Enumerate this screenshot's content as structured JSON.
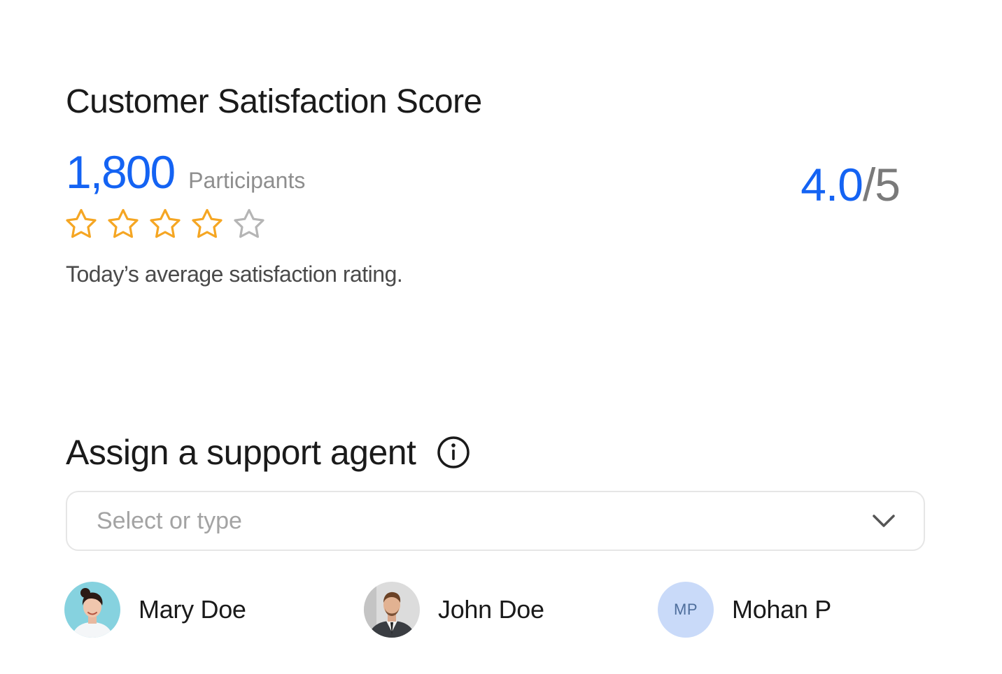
{
  "csat": {
    "title": "Customer Satisfaction Score",
    "participant_count": "1,800",
    "participants_label": "Participants",
    "rating": 4,
    "rating_max": 5,
    "score_value": "4.0",
    "score_separator": "/",
    "score_max": "5",
    "caption": "Today’s average satisfaction rating.",
    "star_filled_color": "#f5a623",
    "star_empty_color": "#b5b5b5",
    "accent_color": "#1463f3"
  },
  "assign": {
    "title": "Assign a support agent",
    "info_icon": "info-icon",
    "select_placeholder": "Select or type",
    "select_value": "",
    "agents": [
      {
        "name": "Mary Doe",
        "avatar": "photo"
      },
      {
        "name": "John Doe",
        "avatar": "photo"
      },
      {
        "name": "Mohan P",
        "avatar": "initials",
        "initials": "MP"
      }
    ]
  }
}
